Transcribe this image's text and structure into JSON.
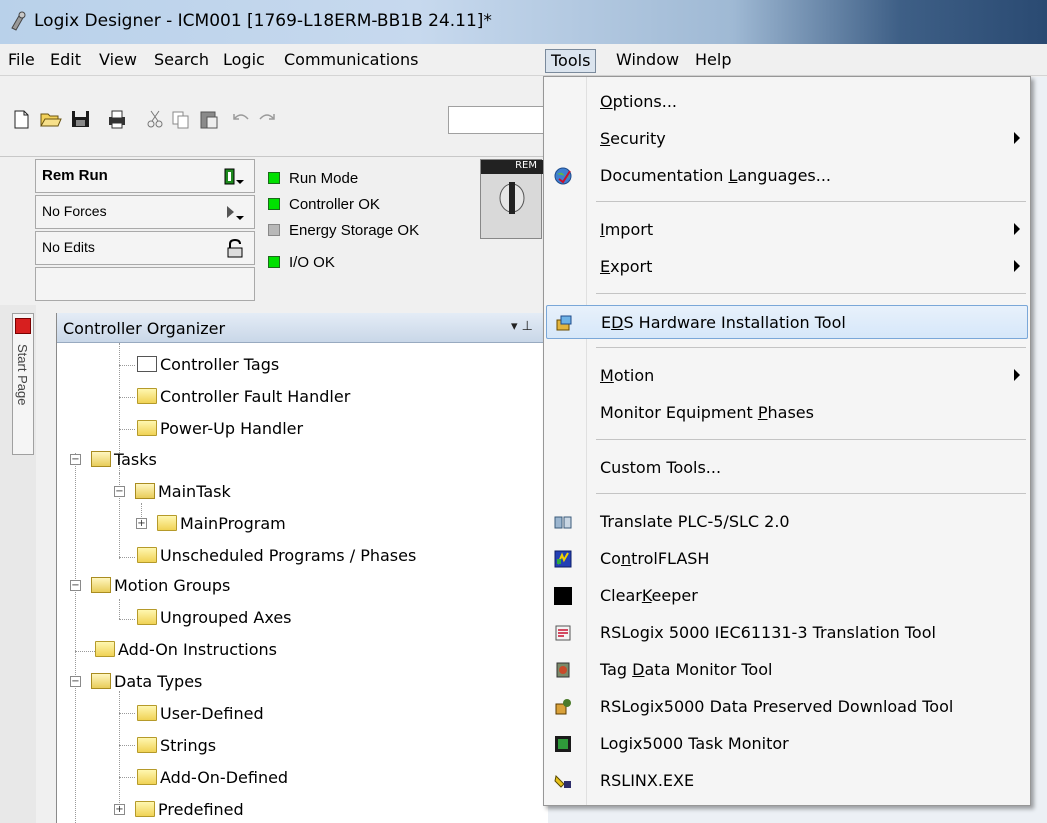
{
  "window": {
    "title": "Logix Designer - ICM001 [1769-L18ERM-BB1B 24.11]*",
    "title_bar_gradient": [
      "#b9d1ea",
      "#2a4a72"
    ]
  },
  "menubar": {
    "items": [
      {
        "label": "File"
      },
      {
        "label": "Edit"
      },
      {
        "label": "View"
      },
      {
        "label": "Search"
      },
      {
        "label": "Logic"
      },
      {
        "label": "Communications"
      },
      {
        "label": "Tools",
        "active": true
      },
      {
        "label": "Window"
      },
      {
        "label": "Help"
      }
    ]
  },
  "toolbar": {
    "icons": [
      "new-file-icon",
      "open-folder-icon",
      "save-icon",
      "print-icon",
      "cut-icon",
      "copy-icon",
      "paste-icon",
      "undo-icon",
      "redo-icon"
    ]
  },
  "status": {
    "mode": "Rem Run",
    "forces": "No Forces",
    "edits": "No Edits",
    "indicators": [
      {
        "label": "Run Mode",
        "state": "green"
      },
      {
        "label": "Controller OK",
        "state": "green"
      },
      {
        "label": "Energy Storage OK",
        "state": "grey"
      },
      {
        "label": "I/O OK",
        "state": "green"
      }
    ],
    "keyswitch_label": "REM"
  },
  "side_tab": {
    "label": "Start Page"
  },
  "organizer": {
    "title": "Controller Organizer",
    "items": [
      "Controller Tags",
      "Controller Fault Handler",
      "Power-Up Handler",
      "Tasks",
      "MainTask",
      "MainProgram",
      "Unscheduled Programs / Phases",
      "Motion Groups",
      "Ungrouped Axes",
      "Add-On Instructions",
      "Data Types",
      "User-Defined",
      "Strings",
      "Add-On-Defined",
      "Predefined"
    ]
  },
  "tools_menu": {
    "highlight_color": "#d6e7f9",
    "items": [
      {
        "pre": "",
        "key": "O",
        "post": "ptions...",
        "submenu": false
      },
      {
        "pre": "",
        "key": "S",
        "post": "ecurity",
        "submenu": true
      },
      {
        "pre": "Documentation ",
        "key": "L",
        "post": "anguages...",
        "submenu": false,
        "icon": "globe-icon"
      },
      {
        "pre": "",
        "key": "I",
        "post": "mport",
        "submenu": true
      },
      {
        "pre": "",
        "key": "E",
        "post": "xport",
        "submenu": true
      },
      {
        "pre": "E",
        "key": "D",
        "post": "S Hardware Installation Tool",
        "submenu": false,
        "icon": "eds-hardware-icon",
        "highlighted": true
      },
      {
        "pre": "",
        "key": "M",
        "post": "otion",
        "submenu": true
      },
      {
        "pre": "Monitor Equipment ",
        "key": "P",
        "post": "hases",
        "submenu": false
      },
      {
        "pre": "Custom Tools...",
        "key": "",
        "post": "",
        "submenu": false
      },
      {
        "pre": "Translate PLC-5/SLC 2.0",
        "key": "",
        "post": "",
        "submenu": false,
        "icon": "translate-icon"
      },
      {
        "pre": "Co",
        "key": "n",
        "post": "trolFLASH",
        "submenu": false,
        "icon": "controlflash-icon"
      },
      {
        "pre": "Clear",
        "key": "K",
        "post": "eeper",
        "submenu": false,
        "icon": "clearkeeper-icon"
      },
      {
        "pre": "RSLogix 5000 IEC61131-3 Translation Tool",
        "key": "",
        "post": "",
        "submenu": false,
        "icon": "iec-translation-icon"
      },
      {
        "pre": "Tag ",
        "key": "D",
        "post": "ata Monitor Tool",
        "submenu": false,
        "icon": "tag-monitor-icon"
      },
      {
        "pre": "RSLogix5000 Data Preserved Download Tool",
        "key": "",
        "post": "",
        "submenu": false,
        "icon": "data-preserved-icon"
      },
      {
        "pre": "Logix5000 Task Monitor",
        "key": "",
        "post": "",
        "submenu": false,
        "icon": "task-monitor-icon"
      },
      {
        "pre": "RSLINX.EXE",
        "key": "",
        "post": "",
        "submenu": false,
        "icon": "rslinx-icon"
      }
    ]
  }
}
